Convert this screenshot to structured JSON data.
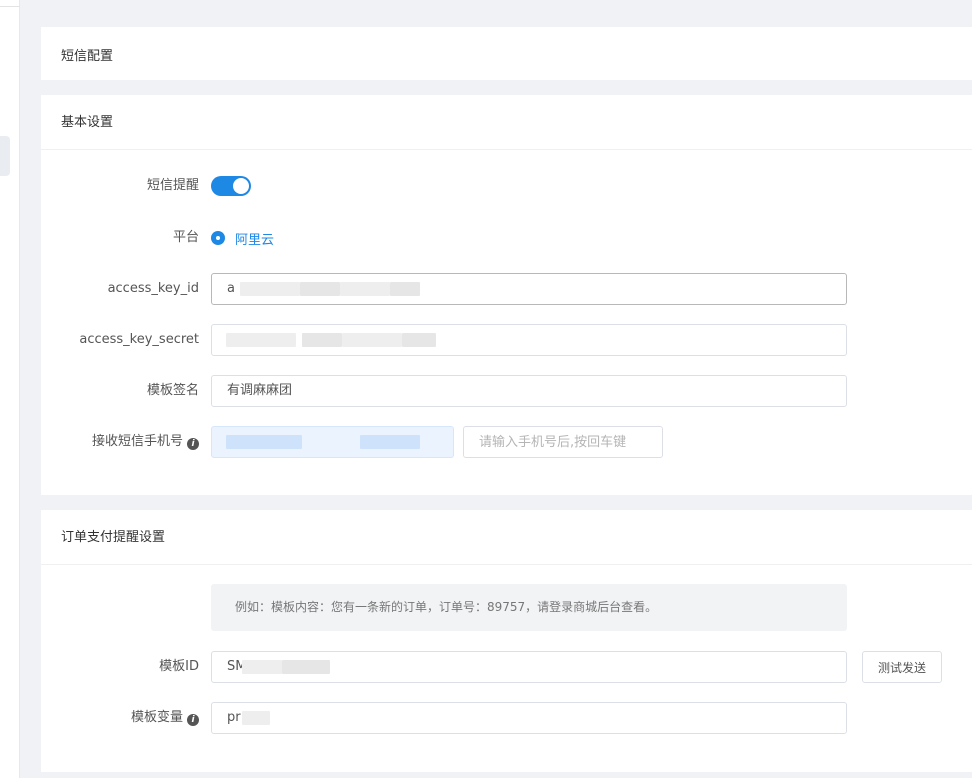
{
  "page": {
    "sms_config_title": "短信配置"
  },
  "basic": {
    "title": "基本设置",
    "sms_reminder_label": "短信提醒",
    "sms_reminder_enabled": true,
    "platform_label": "平台",
    "platform_value": "阿里云",
    "access_key_id_label": "access_key_id",
    "access_key_id_value": "a",
    "access_key_secret_label": "access_key_secret",
    "access_key_secret_value": "",
    "template_sign_label": "模板签名",
    "template_sign_value": "有调麻麻团",
    "phone_label": "接收短信手机号",
    "phone_placeholder": "请输入手机号后,按回车键"
  },
  "order": {
    "title": "订单支付提醒设置",
    "example_text": "例如：模板内容：您有一条新的订单，订单号：89757，请登录商城后台查看。",
    "template_id_label": "模板ID",
    "template_id_value": "SM",
    "test_send_label": "测试发送",
    "template_var_label": "模板变量",
    "template_var_value": "pr"
  },
  "colors": {
    "accent": "#1e88e5",
    "background": "#f0f2f5"
  }
}
